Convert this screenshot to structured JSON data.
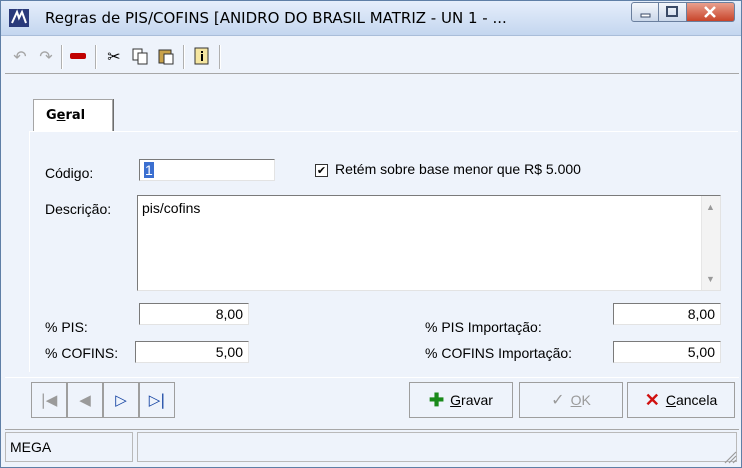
{
  "window": {
    "title": "Regras de PIS/COFINS [ANIDRO DO BRASIL MATRIZ - UN 1 - ...",
    "controls": [
      "minimize",
      "maximize",
      "close"
    ]
  },
  "toolbar": {
    "icons": [
      "undo-icon",
      "redo-icon",
      "remove-icon",
      "cut-icon",
      "copy-icon",
      "paste-icon",
      "info-icon"
    ]
  },
  "tabs": [
    {
      "label_pre": "G",
      "label_ul": "e",
      "label_post": "ral"
    }
  ],
  "form": {
    "codigo_label": "Código:",
    "codigo_value": "1",
    "retem_label": "Retém sobre base menor que R$ 5.000",
    "retem_checked": true,
    "descricao_label": "Descrição:",
    "descricao_value": "pis/cofins",
    "pis_label": "% PIS:",
    "pis_value": "8,00",
    "cofins_label": "% COFINS:",
    "cofins_value": "5,00",
    "pis_imp_label": "% PIS Importação:",
    "pis_imp_value": "8,00",
    "cofins_imp_label": "% COFINS Importação:",
    "cofins_imp_value": "5,00"
  },
  "actions": {
    "gravar_ul": "G",
    "gravar_rest": "ravar",
    "ok_ul": "O",
    "ok_rest": "K",
    "cancela_ul": "C",
    "cancela_rest": "ancela"
  },
  "status": {
    "panel1": "MEGA"
  },
  "colors": {
    "accent": "#1a6a1a",
    "cancel_red": "#d01010",
    "nav_blue": "#1040a0"
  }
}
